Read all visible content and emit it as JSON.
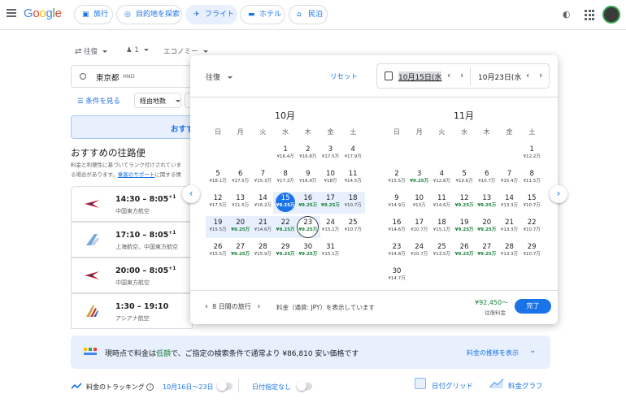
{
  "header": {
    "logo": "Google",
    "chips": [
      {
        "label": "旅行",
        "icon": "suitcase-icon"
      },
      {
        "label": "目的地を探索",
        "icon": "explore-icon"
      },
      {
        "label": "フライト",
        "icon": "airplane-icon",
        "active": true
      },
      {
        "label": "ホテル",
        "icon": "bed-icon"
      },
      {
        "label": "民泊",
        "icon": "house-icon"
      }
    ]
  },
  "search": {
    "trip_type": "往復",
    "passengers": "1",
    "cabin": "エコノミー",
    "origin": "東京都",
    "origin_code": "HND",
    "filters_label": "条件を見る",
    "stops_label": "経由地数",
    "search_button": "おすす"
  },
  "results": {
    "title": "おすすめの往路便",
    "desc_line1": "料金と利便性に基づいてランク付けされていま",
    "desc_line2_pre": "る場合があります。",
    "desc_line2_link": "乗客のサポート",
    "desc_line2_post": "に関する情",
    "flights": [
      {
        "time": "14:30 – 8:05",
        "sup": "+1",
        "airline": "中国東方航空"
      },
      {
        "time": "17:10 – 8:05",
        "sup": "+1",
        "airline": "上海航空、中国東方航空"
      },
      {
        "time": "20:00 – 8:05",
        "sup": "+1",
        "airline": "中国東方航空"
      },
      {
        "time": "1:30 – 19:10",
        "sup": "",
        "airline": "アシアナ航空"
      }
    ]
  },
  "calendar": {
    "trip_type": "往復",
    "reset": "リセット",
    "depart": "10月15日(水",
    "return": "10月23日(水",
    "weekdays": [
      "日",
      "月",
      "火",
      "水",
      "木",
      "金",
      "土"
    ],
    "months": [
      {
        "name": "10月",
        "weeks": [
          [
            null,
            null,
            null,
            {
              "d": "1",
              "p": "¥16.4万"
            },
            {
              "d": "2",
              "p": "¥16.8万"
            },
            {
              "d": "3",
              "p": "¥17.5万"
            },
            {
              "d": "4",
              "p": "¥17.9万"
            }
          ],
          [
            {
              "d": "5",
              "p": "¥18.1万"
            },
            {
              "d": "6",
              "p": "¥17.5万"
            },
            {
              "d": "7",
              "p": "¥15.3万"
            },
            {
              "d": "8",
              "p": "¥17.3万"
            },
            {
              "d": "9",
              "p": "¥16.9万"
            },
            {
              "d": "10",
              "p": "¥18万"
            },
            {
              "d": "11",
              "p": "¥14.5万"
            }
          ],
          [
            {
              "d": "12",
              "p": "¥17.5万"
            },
            {
              "d": "13",
              "p": "¥11.5万"
            },
            {
              "d": "14",
              "p": "¥16.2万"
            },
            {
              "d": "15",
              "p": "¥9.25万",
              "g": true,
              "sel": true
            },
            {
              "d": "16",
              "p": "¥9.25万",
              "g": true
            },
            {
              "d": "17",
              "p": "¥9.25万",
              "g": true
            },
            {
              "d": "18",
              "p": "¥10.7万"
            }
          ],
          [
            {
              "d": "19",
              "p": "¥15.5万"
            },
            {
              "d": "20",
              "p": "¥9.25万",
              "g": true
            },
            {
              "d": "21",
              "p": "¥14.6万"
            },
            {
              "d": "22",
              "p": "¥9.25万",
              "g": true
            },
            {
              "d": "23",
              "p": "¥9.25万",
              "g": true,
              "ret": true
            },
            {
              "d": "24",
              "p": "¥15.1万"
            },
            {
              "d": "25",
              "p": "¥10.7万"
            }
          ],
          [
            {
              "d": "26",
              "p": "¥15.5万"
            },
            {
              "d": "27",
              "p": "¥9.25万",
              "g": true
            },
            {
              "d": "28",
              "p": "¥15.9万"
            },
            {
              "d": "29",
              "p": "¥9.25万",
              "g": true
            },
            {
              "d": "30",
              "p": "¥9.25万",
              "g": true
            },
            {
              "d": "31",
              "p": "¥15.1万"
            },
            null
          ]
        ]
      },
      {
        "name": "11月",
        "weeks": [
          [
            null,
            null,
            null,
            null,
            null,
            null,
            {
              "d": "1",
              "p": "¥12.2万"
            }
          ],
          [
            {
              "d": "2",
              "p": "¥15.5万"
            },
            {
              "d": "3",
              "p": "¥9.25万",
              "g": true
            },
            {
              "d": "4",
              "p": "¥12.8万"
            },
            {
              "d": "5",
              "p": "¥10.6万"
            },
            {
              "d": "6",
              "p": "¥10.7万"
            },
            {
              "d": "7",
              "p": "¥15.4万"
            },
            {
              "d": "8",
              "p": "¥11.5万"
            }
          ],
          [
            {
              "d": "9",
              "p": "¥14.9万"
            },
            {
              "d": "10",
              "p": "¥13万"
            },
            {
              "d": "11",
              "p": "¥14.6万"
            },
            {
              "d": "12",
              "p": "¥9.25万",
              "g": true
            },
            {
              "d": "13",
              "p": "¥9.25万",
              "g": true
            },
            {
              "d": "14",
              "p": "¥13.3万"
            },
            {
              "d": "15",
              "p": "¥10.7万"
            }
          ],
          [
            {
              "d": "16",
              "p": "¥14.6万"
            },
            {
              "d": "17",
              "p": "¥10.7万"
            },
            {
              "d": "18",
              "p": "¥15.1万"
            },
            {
              "d": "19",
              "p": "¥9.25万",
              "g": true
            },
            {
              "d": "20",
              "p": "¥9.25万",
              "g": true
            },
            {
              "d": "21",
              "p": "¥13.3万"
            },
            {
              "d": "22",
              "p": "¥10.7万"
            }
          ],
          [
            {
              "d": "23",
              "p": "¥14.8万"
            },
            {
              "d": "24",
              "p": "¥10.7万"
            },
            {
              "d": "25",
              "p": "¥13.5万"
            },
            {
              "d": "26",
              "p": "¥9.25万",
              "g": true
            },
            {
              "d": "27",
              "p": "¥9.25万",
              "g": true
            },
            {
              "d": "28",
              "p": "¥13.3万"
            },
            {
              "d": "29",
              "p": "¥10.7万"
            }
          ],
          [
            {
              "d": "30",
              "p": "¥14.7万"
            },
            null,
            null,
            null,
            null,
            null,
            null
          ]
        ]
      }
    ],
    "footer": {
      "duration": "8 日間の旅行",
      "currency_note": "料金（通貨: JPY）を表示しています",
      "price": "¥92,450〜",
      "price_label": "往復料金",
      "done": "完了"
    }
  },
  "banner": {
    "pre": "現時点で料金は",
    "highlight": "低額",
    "post": "で、ご指定の検索条件で通常より ¥86,810 安い価格です",
    "link": "料金の推移を表示"
  },
  "tracking": {
    "label": "料金のトラッキング",
    "dates": "10月16日〜23日",
    "no_dates": "日付指定なし",
    "date_grid": "日付グリッド",
    "price_graph": "料金グラフ"
  },
  "colors": {
    "accent": "#1a73e8",
    "green": "#188038",
    "range": "#e8f0fe"
  }
}
